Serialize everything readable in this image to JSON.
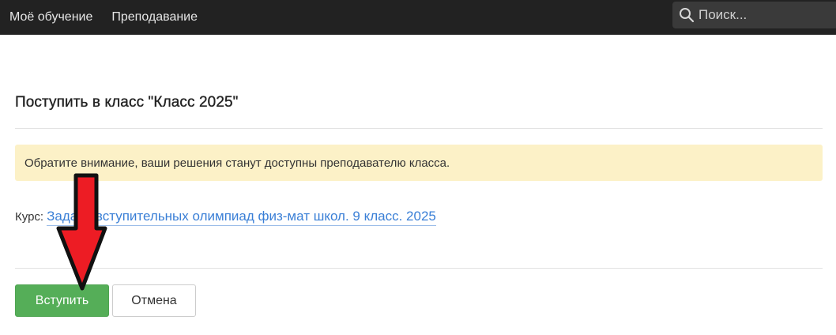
{
  "navbar": {
    "links": [
      "Моё обучение",
      "Преподавание"
    ],
    "search_placeholder": "Поиск..."
  },
  "page": {
    "title": "Поступить в класс \"Класс 2025\"",
    "notice": "Обратите внимание, ваши решения станут доступны преподавателю класса.",
    "course_label": "Курс:",
    "course_link": "Задачи вступительных олимпиад физ-мат школ. 9 класс. 2025"
  },
  "buttons": {
    "join": "Вступить",
    "cancel": "Отмена"
  },
  "colors": {
    "navbar_bg": "#222222",
    "notice_bg": "#fcf1c7",
    "primary_button": "#55ae58",
    "link": "#3a7fd6",
    "arrow_annotation": "#ed1c24"
  },
  "icons": {
    "search": "search-icon",
    "annotation": "red-arrow-annotation"
  }
}
